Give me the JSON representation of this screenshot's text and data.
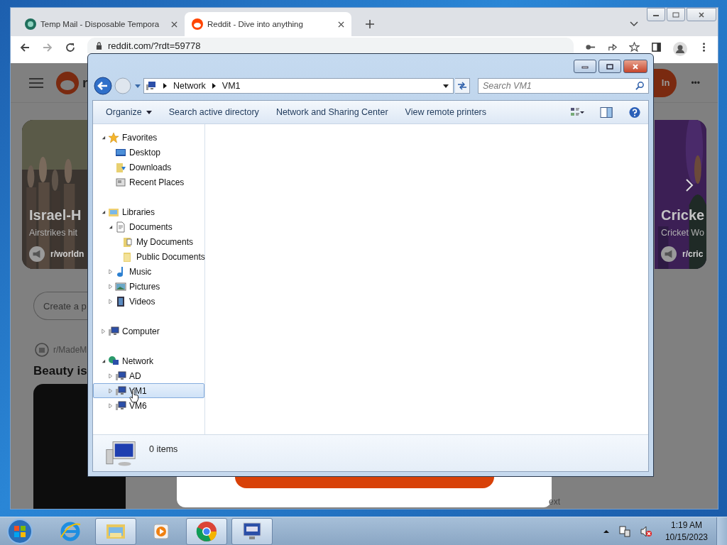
{
  "browser": {
    "tabs": [
      {
        "title": "Temp Mail - Disposable Tempora",
        "kind": "tempmail",
        "selected": false
      },
      {
        "title": "Reddit - Dive into anything",
        "kind": "reddit",
        "selected": true
      }
    ],
    "url": "reddit.com/?rdt=59778"
  },
  "reddit": {
    "logo_text": "r",
    "login": "In",
    "more": "•••",
    "cards": [
      {
        "title": "Israel-H",
        "subtitle": "Airstrikes hit",
        "community": "r/worldn",
        "kind": "crowd"
      },
      {
        "title": "Cricke",
        "subtitle": "Cricket Wo",
        "community": "r/cric",
        "kind": "sport"
      }
    ],
    "create_post": "Create a p",
    "post": {
      "community": "r/MadeM",
      "title": "Beauty is"
    },
    "modal_footer": "ext"
  },
  "explorer": {
    "path": [
      "Network",
      "VM1"
    ],
    "search": {
      "placeholder": "Search VM1"
    },
    "toolbar": [
      {
        "label": "Organize",
        "menu": true
      },
      {
        "label": "Search active directory",
        "menu": false
      },
      {
        "label": "Network and Sharing Center",
        "menu": false
      },
      {
        "label": "View remote printers",
        "menu": false
      }
    ],
    "tree": [
      {
        "label": "Favorites",
        "kind": "star",
        "expanded": true,
        "selected": false,
        "children": [
          {
            "label": "Desktop",
            "kind": "desktop",
            "selected": false
          },
          {
            "label": "Downloads",
            "kind": "downloads",
            "selected": false
          },
          {
            "label": "Recent Places",
            "kind": "recent",
            "selected": false
          }
        ]
      },
      {
        "label": "Libraries",
        "kind": "library",
        "expanded": true,
        "selected": false,
        "children": [
          {
            "label": "Documents",
            "kind": "document",
            "expanded": true,
            "selected": false,
            "children": [
              {
                "label": "My Documents",
                "kind": "docfolder",
                "selected": false
              },
              {
                "label": "Public Documents",
                "kind": "folder",
                "selected": false
              }
            ]
          },
          {
            "label": "Music",
            "kind": "music",
            "expanded": false,
            "selected": false
          },
          {
            "label": "Pictures",
            "kind": "pictures",
            "expanded": false,
            "selected": false
          },
          {
            "label": "Videos",
            "kind": "videos",
            "expanded": false,
            "selected": false
          }
        ]
      },
      {
        "label": "Computer",
        "kind": "computer",
        "expanded": false,
        "selected": false
      },
      {
        "label": "Network",
        "kind": "network",
        "expanded": true,
        "selected": false,
        "children": [
          {
            "label": "AD",
            "kind": "computer",
            "expanded": false,
            "selected": false
          },
          {
            "label": "VM1",
            "kind": "computer",
            "expanded": false,
            "selected": true
          },
          {
            "label": "VM6",
            "kind": "computer",
            "expanded": false,
            "selected": false
          }
        ]
      }
    ],
    "status": "0 items"
  },
  "taskbar": {
    "apps": [
      {
        "kind": "ie",
        "active": false
      },
      {
        "kind": "explorer",
        "active": true
      },
      {
        "kind": "media",
        "active": false
      },
      {
        "kind": "chrome",
        "active": true
      },
      {
        "kind": "remote",
        "active": true
      }
    ],
    "time": "1:19 AM",
    "date": "10/15/2023"
  }
}
